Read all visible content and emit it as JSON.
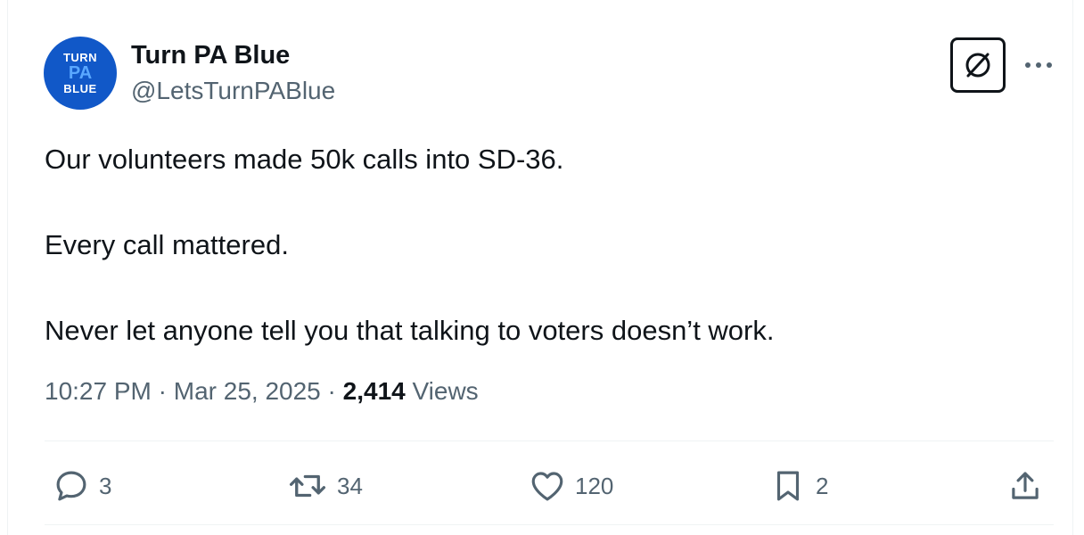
{
  "author": {
    "avatar_lines": [
      "TURN",
      "PA",
      "BLUE"
    ],
    "name": "Turn PA Blue",
    "handle": "@LetsTurnPABlue"
  },
  "header": {
    "grok_icon": "grok-icon",
    "more_icon": "more-dots-icon"
  },
  "tweet": {
    "paragraphs": [
      "Our volunteers made 50k calls into SD-36.",
      "Every call mattered.",
      "Never let anyone tell you that talking to voters doesn’t work."
    ]
  },
  "meta": {
    "time": "10:27 PM",
    "separator": "·",
    "date": "Mar 25, 2025",
    "views_count": "2,414",
    "views_label": "Views"
  },
  "actions": {
    "replies": "3",
    "reposts": "34",
    "likes": "120",
    "bookmarks": "2"
  },
  "colors": {
    "avatar_bg": "#1158c8",
    "text_primary": "#0f1419",
    "text_secondary": "#536471",
    "divider": "#eff3f4"
  }
}
